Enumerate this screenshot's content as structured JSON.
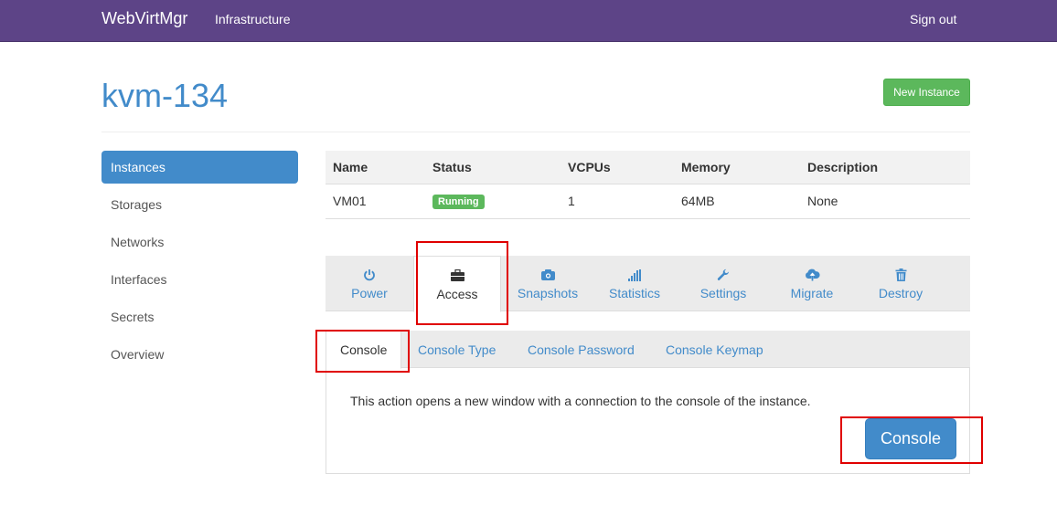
{
  "navbar": {
    "brand": "WebVirtMgr",
    "infrastructure": "Infrastructure",
    "signout": "Sign out",
    "bg_color": "#5d4487"
  },
  "page": {
    "title": "kvm-134",
    "new_instance": "New Instance"
  },
  "sidebar": {
    "items": [
      {
        "label": "Instances",
        "active": true
      },
      {
        "label": "Storages"
      },
      {
        "label": "Networks"
      },
      {
        "label": "Interfaces"
      },
      {
        "label": "Secrets"
      },
      {
        "label": "Overview"
      }
    ]
  },
  "table": {
    "headers": [
      "Name",
      "Status",
      "VCPUs",
      "Memory",
      "Description"
    ],
    "rows": [
      {
        "name": "VM01",
        "status": "Running",
        "vcpus": "1",
        "memory": "64MB",
        "description": "None"
      }
    ]
  },
  "actions": {
    "tabs": [
      {
        "label": "Power",
        "icon": "power-icon"
      },
      {
        "label": "Access",
        "icon": "briefcase-icon",
        "active": true
      },
      {
        "label": "Snapshots",
        "icon": "camera-icon"
      },
      {
        "label": "Statistics",
        "icon": "signal-bars-icon"
      },
      {
        "label": "Settings",
        "icon": "wrench-icon"
      },
      {
        "label": "Migrate",
        "icon": "cloud-upload-icon"
      },
      {
        "label": "Destroy",
        "icon": "trash-icon"
      }
    ]
  },
  "access": {
    "subtabs": [
      {
        "label": "Console",
        "active": true
      },
      {
        "label": "Console Type"
      },
      {
        "label": "Console Password"
      },
      {
        "label": "Console Keymap"
      }
    ],
    "description": "This action opens a new window with a connection to the console of the instance.",
    "console_button": "Console"
  },
  "colors": {
    "primary": "#428bca",
    "success": "#5cb85c",
    "highlight": "#e00000"
  }
}
